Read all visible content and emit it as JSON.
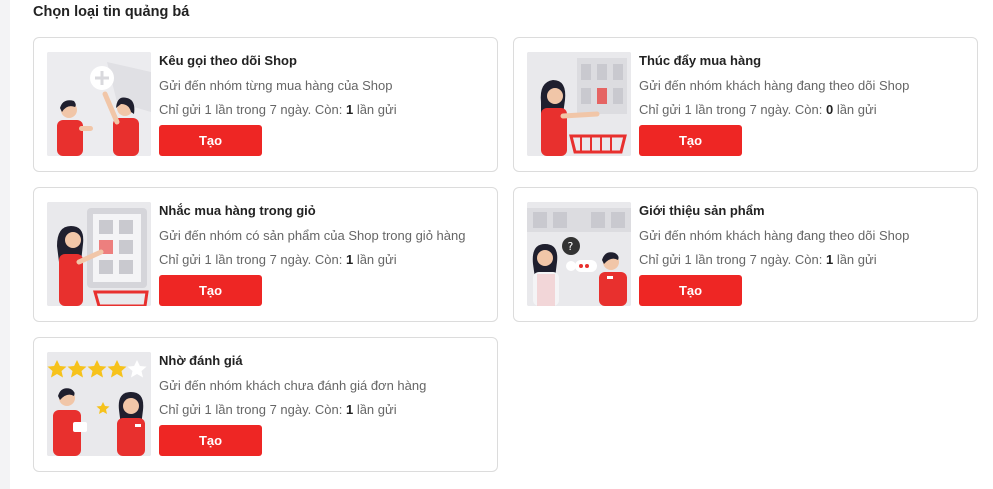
{
  "section_title": "Chọn loại tin quảng bá",
  "colors": {
    "accent": "#ee2624",
    "border": "#dcdcdc"
  },
  "cards": [
    {
      "title": "Kêu gọi theo dõi Shop",
      "description": "Gửi đến nhóm từng mua hàng của Shop",
      "quota_prefix": "Chỉ gửi 1 lần trong 7 ngày. Còn: ",
      "remaining": "1",
      "quota_suffix": " lần gửi",
      "button_label": "Tạo",
      "illustration": "follow-shop-illustration"
    },
    {
      "title": "Thúc đẩy mua hàng",
      "description": "Gửi đến nhóm khách hàng đang theo dõi Shop",
      "quota_prefix": "Chỉ gửi 1 lần trong 7 ngày. Còn: ",
      "remaining": "0",
      "quota_suffix": " lần gửi",
      "button_label": "Tạo",
      "illustration": "shopping-cart-illustration"
    },
    {
      "title": "Nhắc mua hàng trong giỏ",
      "description": "Gửi đến nhóm có sản phẩm của Shop trong giỏ hàng",
      "quota_prefix": "Chỉ gửi 1 lần trong 7 ngày. Còn: ",
      "remaining": "1",
      "quota_suffix": " lần gửi",
      "button_label": "Tạo",
      "illustration": "cart-reminder-illustration"
    },
    {
      "title": "Giới thiệu sản phẩm",
      "description": "Gửi đến nhóm khách hàng đang theo dõi Shop",
      "quota_prefix": "Chỉ gửi 1 lần trong 7 ngày. Còn: ",
      "remaining": "1",
      "quota_suffix": " lần gửi",
      "button_label": "Tạo",
      "illustration": "product-intro-illustration"
    },
    {
      "title": "Nhờ đánh giá",
      "description": "Gửi đến nhóm khách chưa đánh giá đơn hàng",
      "quota_prefix": "Chỉ gửi 1 lần trong 7 ngày. Còn: ",
      "remaining": "1",
      "quota_suffix": " lần gửi",
      "button_label": "Tạo",
      "illustration": "review-request-illustration"
    }
  ]
}
